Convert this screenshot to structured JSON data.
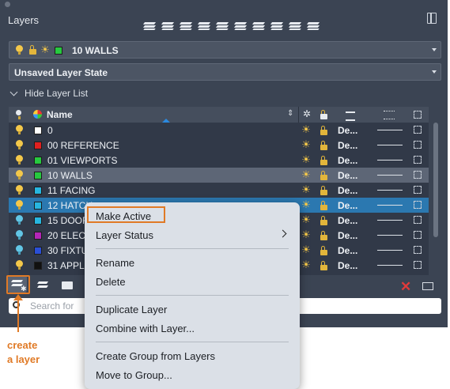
{
  "panel": {
    "title": "Layers"
  },
  "current_layer": {
    "name": "10 WALLS",
    "color": "#27c93f"
  },
  "layer_state": {
    "value": "Unsaved Layer State"
  },
  "layer_list_toggle": {
    "label": "Hide Layer List"
  },
  "columns": {
    "name": "Name"
  },
  "layers": [
    {
      "name": "0",
      "color": "#ffffff",
      "bulb": "yellow",
      "linetype": "De...",
      "state": "normal"
    },
    {
      "name": "00 REFERENCE",
      "color": "#e02020",
      "bulb": "yellow",
      "linetype": "De...",
      "state": "normal"
    },
    {
      "name": "01 VIEWPORTS",
      "color": "#27c93f",
      "bulb": "yellow",
      "linetype": "De...",
      "state": "normal"
    },
    {
      "name": "10 WALLS",
      "color": "#27c93f",
      "bulb": "yellow",
      "linetype": "De...",
      "state": "selected"
    },
    {
      "name": "11 FACING",
      "color": "#27b6e0",
      "bulb": "yellow",
      "linetype": "De...",
      "state": "normal"
    },
    {
      "name": "12 HATCH",
      "color": "#27b6e0",
      "bulb": "yellow",
      "linetype": "De...",
      "state": "highlighted"
    },
    {
      "name": "15 DOOR",
      "color": "#27b6e0",
      "bulb": "blue",
      "linetype": "De...",
      "state": "normal"
    },
    {
      "name": "20 ELEC",
      "color": "#b326b8",
      "bulb": "blue",
      "linetype": "De...",
      "state": "normal"
    },
    {
      "name": "30 FIXTU",
      "color": "#2a4fd6",
      "bulb": "blue",
      "linetype": "De...",
      "state": "normal"
    },
    {
      "name": "31 APPL",
      "color": "#111111",
      "bulb": "yellow",
      "linetype": "De...",
      "state": "normal"
    }
  ],
  "search": {
    "placeholder": "Search for"
  },
  "context_menu": {
    "make_active": "Make Active",
    "layer_status": "Layer Status",
    "rename": "Rename",
    "delete": "Delete",
    "duplicate": "Duplicate Layer",
    "combine": "Combine with Layer...",
    "create_group": "Create Group from Layers",
    "move_to_group": "Move to Group..."
  },
  "annotation": {
    "line1": "create",
    "line2": "a layer",
    "color": "#e07a26"
  }
}
